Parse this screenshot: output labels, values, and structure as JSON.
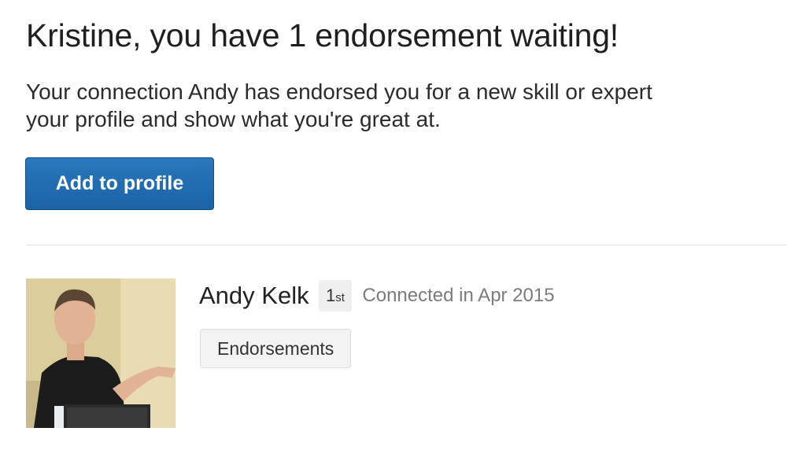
{
  "notification": {
    "headline": "Kristine, you have 1 endorsement waiting!",
    "message_line1": "Your connection Andy has endorsed you for a new skill or expert",
    "message_line2": "your profile and show what you're great at.",
    "add_button_label": "Add to profile"
  },
  "endorser": {
    "name": "Andy Kelk",
    "degree": "1",
    "degree_suffix": "st",
    "connected_text": "Connected in Apr 2015",
    "endorsements_button_label": "Endorsements",
    "avatar_icon": "person-photo"
  },
  "colors": {
    "primary_button": "#1b62a6",
    "secondary_button": "#f3f3f3",
    "muted_text": "#7b7b7b"
  }
}
